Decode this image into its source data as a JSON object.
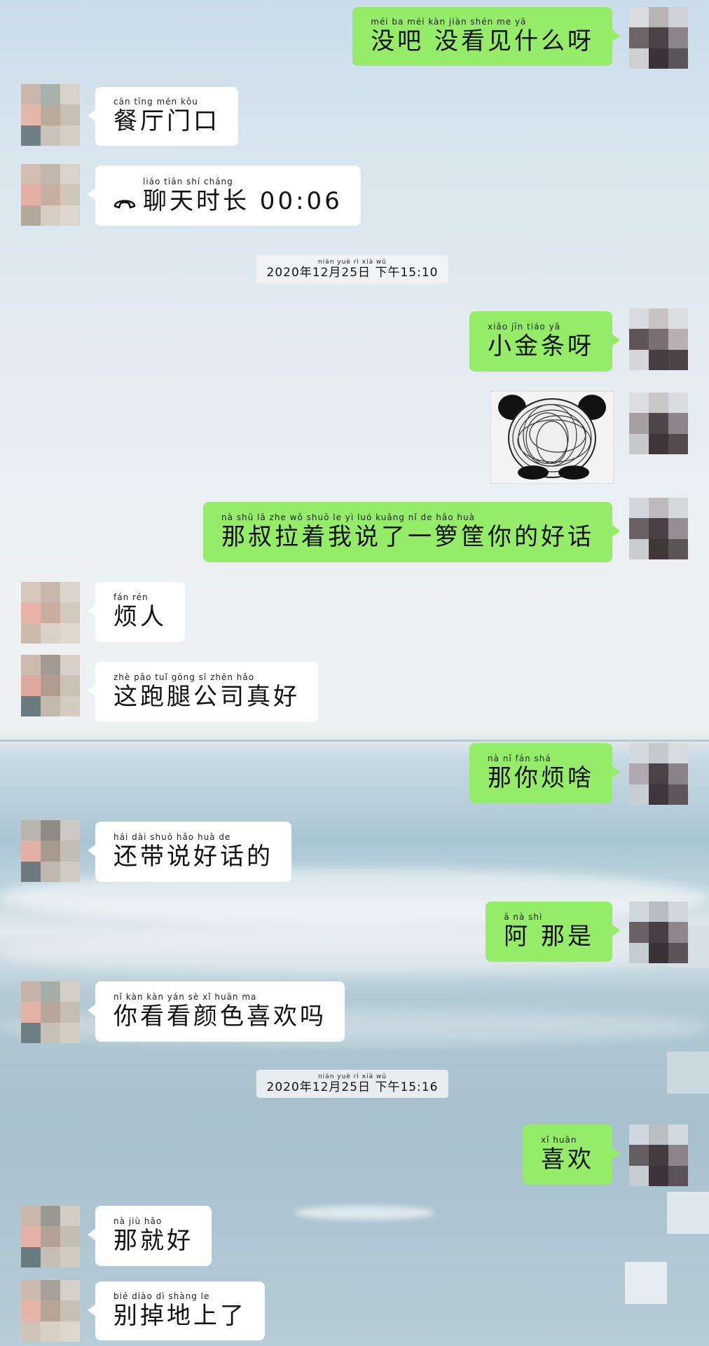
{
  "messages": [
    {
      "side": "right",
      "pinyin": "méi ba   méi kàn jiàn shén me yā",
      "text": "没吧 没看见什么呀"
    },
    {
      "side": "left",
      "pinyin": "cān tīng mén kǒu",
      "text": "餐厅门口"
    },
    {
      "side": "left",
      "pinyin": "liáo tiān shí cháng",
      "text": "聊天时长 00:06",
      "icon": "phone-hangup-icon"
    },
    {
      "side": "right",
      "pinyin": "xiǎo jīn tiáo yā",
      "text": "小金条呀"
    },
    {
      "side": "right",
      "pinyin": "nà shū lā zhe wǒ shuō le yì luó kuāng nǐ de hǎo huà",
      "text": "那叔拉着我说了一箩筐你的好话"
    },
    {
      "side": "left",
      "pinyin": "fán rén",
      "text": "烦人"
    },
    {
      "side": "left",
      "pinyin": "zhè pǎo tuǐ gōng sī zhēn hǎo",
      "text": "这跑腿公司真好"
    },
    {
      "side": "right",
      "pinyin": "nà nǐ fán shá",
      "text": "那你烦啥"
    },
    {
      "side": "left",
      "pinyin": "hái dài shuō hǎo huà de",
      "text": "还带说好话的"
    },
    {
      "side": "right",
      "pinyin": "ā   nà shì",
      "text": "阿 那是"
    },
    {
      "side": "left",
      "pinyin": "nǐ kàn kàn yán sè xǐ huān ma",
      "text": "你看看颜色喜欢吗"
    },
    {
      "side": "right",
      "pinyin": "xǐ huān",
      "text": "喜欢"
    },
    {
      "side": "left",
      "pinyin": "nà jiù hǎo",
      "text": "那就好"
    },
    {
      "side": "left",
      "pinyin": "bié diào dì shàng le",
      "text": "别掉地上了"
    }
  ],
  "timestamps": [
    {
      "pinyin": "nián   yuè   rì   xià wǔ",
      "text": "2020年12月25日 下午15:10"
    },
    {
      "pinyin": "nián   yuè   rì   xià wǔ",
      "text": "2020年12月25日 下午15:16"
    }
  ],
  "sticker": {
    "icon": "panda-meme-sticker-icon"
  },
  "colors": {
    "right_bubble": "#95ec69",
    "left_bubble": "#ffffff"
  }
}
